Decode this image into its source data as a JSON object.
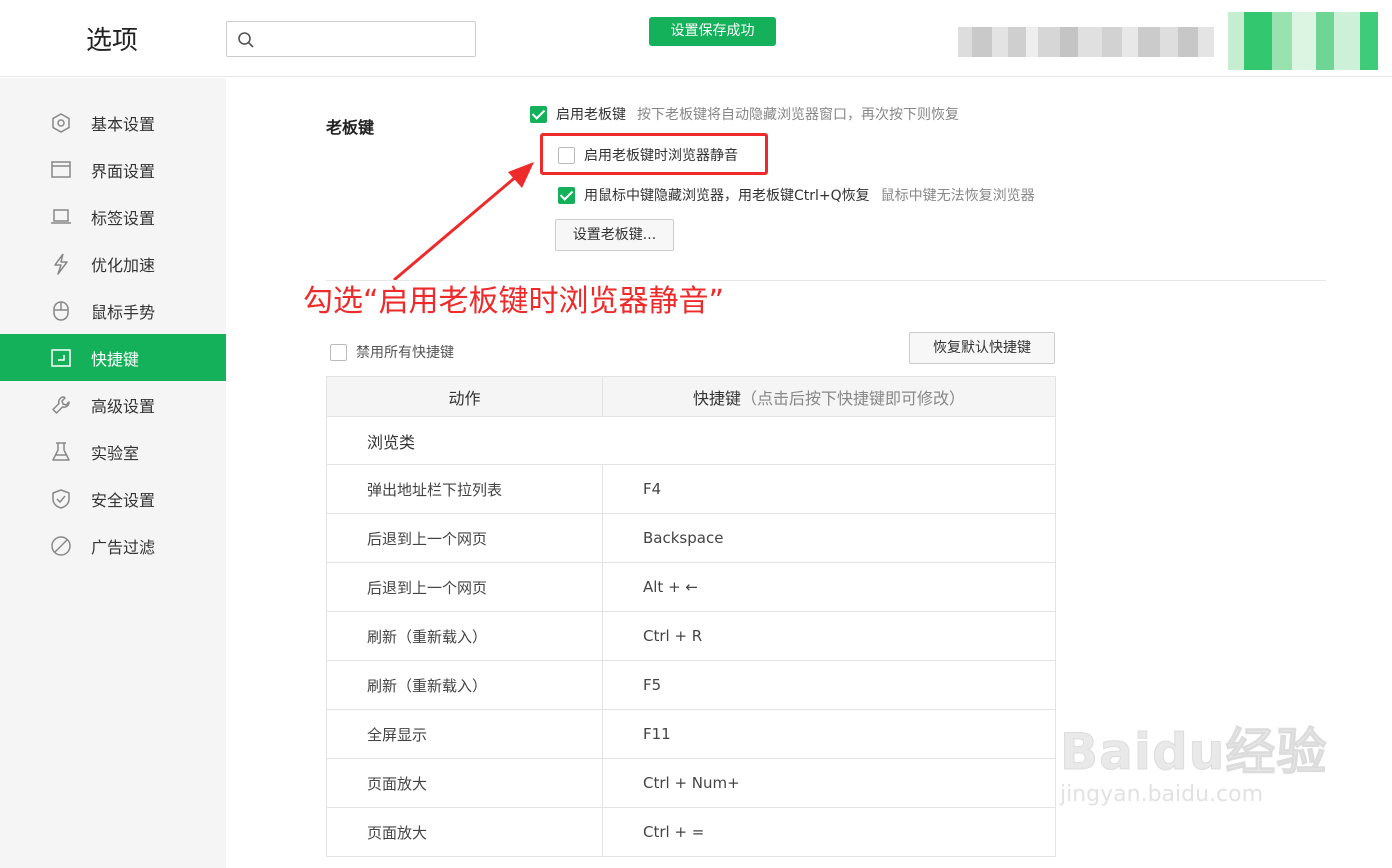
{
  "header": {
    "title": "选项",
    "search_placeholder": "",
    "toast": "设置保存成功"
  },
  "sidebar": {
    "items": [
      {
        "label": "基本设置",
        "icon": "settings-hex-icon",
        "active": false
      },
      {
        "label": "界面设置",
        "icon": "window-icon",
        "active": false
      },
      {
        "label": "标签设置",
        "icon": "tab-icon",
        "active": false
      },
      {
        "label": "优化加速",
        "icon": "lightning-icon",
        "active": false
      },
      {
        "label": "鼠标手势",
        "icon": "mouse-icon",
        "active": false
      },
      {
        "label": "快捷键",
        "icon": "keyboard-icon",
        "active": true
      },
      {
        "label": "高级设置",
        "icon": "wrench-icon",
        "active": false
      },
      {
        "label": "实验室",
        "icon": "flask-icon",
        "active": false
      },
      {
        "label": "安全设置",
        "icon": "shield-icon",
        "active": false
      },
      {
        "label": "广告过滤",
        "icon": "block-icon",
        "active": false
      }
    ]
  },
  "boss_key": {
    "section_title": "老板键",
    "enable_label": "启用老板键",
    "enable_hint": "按下老板键将自动隐藏浏览器窗口，再次按下则恢复",
    "mute_label": "启用老板键时浏览器静音",
    "middle_click_label": "用鼠标中键隐藏浏览器，用老板键Ctrl+Q恢复",
    "middle_click_hint": "鼠标中键无法恢复浏览器",
    "set_button": "设置老板键..."
  },
  "annotation": "勾选“启用老板键时浏览器静音”",
  "shortcuts": {
    "disable_all_label": "禁用所有快捷键",
    "restore_button": "恢复默认快捷键",
    "col_action": "动作",
    "col_key": "快捷键",
    "col_key_hint": "（点击后按下快捷键即可修改）",
    "group_browse": "浏览类",
    "rows": [
      {
        "action": "弹出地址栏下拉列表",
        "key": "F4"
      },
      {
        "action": "后退到上一个网页",
        "key": "Backspace"
      },
      {
        "action": "后退到上一个网页",
        "key": "Alt + ←"
      },
      {
        "action": "刷新（重新载入）",
        "key": "Ctrl + R"
      },
      {
        "action": "刷新（重新载入）",
        "key": "F5"
      },
      {
        "action": "全屏显示",
        "key": "F11"
      },
      {
        "action": "页面放大",
        "key": "Ctrl + Num+"
      },
      {
        "action": "页面放大",
        "key": "Ctrl + ="
      }
    ]
  },
  "watermark": {
    "brand": "Baidu经验",
    "url": "jingyan.baidu.com"
  },
  "colors": {
    "accent": "#14b15a",
    "annotation": "#ee2a2a"
  }
}
